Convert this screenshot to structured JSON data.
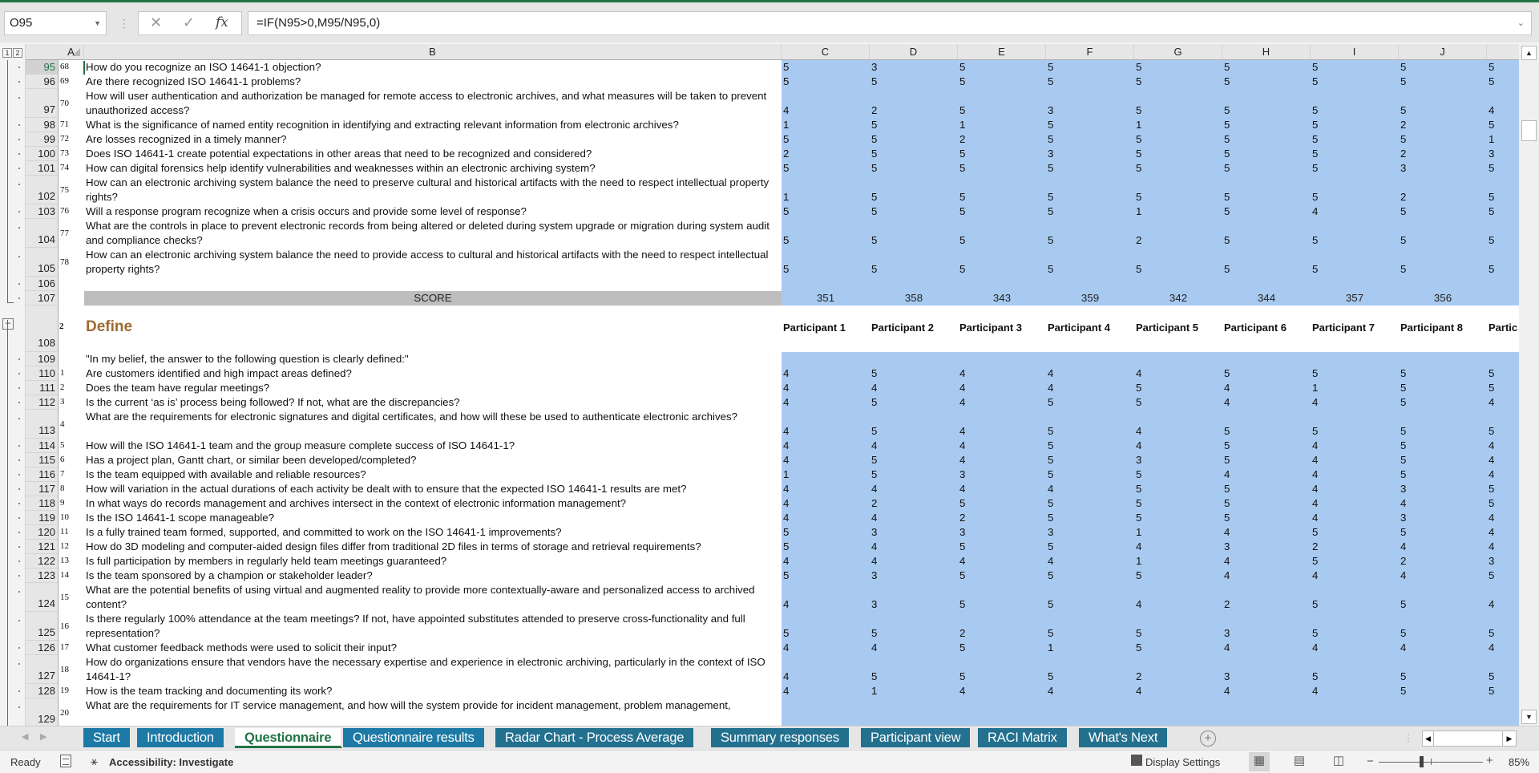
{
  "formula_bar": {
    "name_box": "O95",
    "cancel_icon": "✕",
    "enter_icon": "✓",
    "fx_label": "fx",
    "formula": "=IF(N95>0,M95/N95,0)"
  },
  "outline_levels": [
    "1",
    "2"
  ],
  "columns": [
    "A",
    "B",
    "C",
    "D",
    "E",
    "F",
    "G",
    "H",
    "I",
    "J"
  ],
  "section1_rows": [
    {
      "row": "95",
      "num": "68",
      "q": "How do you recognize an ISO 14641-1 objection?",
      "tall": false,
      "scores": [
        "5",
        "3",
        "5",
        "5",
        "5",
        "5",
        "5",
        "5",
        "5"
      ]
    },
    {
      "row": "96",
      "num": "69",
      "q": "Are there recognized ISO 14641-1 problems?",
      "tall": false,
      "scores": [
        "5",
        "5",
        "5",
        "5",
        "5",
        "5",
        "5",
        "5",
        "5"
      ]
    },
    {
      "row": "97",
      "num": "70",
      "q": "How will user authentication and authorization be managed for remote access to electronic archives, and what measures will be taken to prevent unauthorized access?",
      "tall": true,
      "scores": [
        "4",
        "2",
        "5",
        "3",
        "5",
        "5",
        "5",
        "5",
        "4"
      ]
    },
    {
      "row": "98",
      "num": "71",
      "q": "What is the significance of named entity recognition in identifying and extracting relevant information from electronic archives?",
      "tall": false,
      "scores": [
        "1",
        "5",
        "1",
        "5",
        "1",
        "5",
        "5",
        "2",
        "5"
      ]
    },
    {
      "row": "99",
      "num": "72",
      "q": "Are losses recognized in a timely manner?",
      "tall": false,
      "scores": [
        "5",
        "5",
        "2",
        "5",
        "5",
        "5",
        "5",
        "5",
        "1"
      ]
    },
    {
      "row": "100",
      "num": "73",
      "q": "Does ISO 14641-1 create potential expectations in other areas that need to be recognized and considered?",
      "tall": false,
      "scores": [
        "2",
        "5",
        "5",
        "3",
        "5",
        "5",
        "5",
        "2",
        "3"
      ]
    },
    {
      "row": "101",
      "num": "74",
      "q": "How can digital forensics help identify vulnerabilities and weaknesses within an electronic archiving system?",
      "tall": false,
      "scores": [
        "5",
        "5",
        "5",
        "5",
        "5",
        "5",
        "5",
        "3",
        "5"
      ]
    },
    {
      "row": "102",
      "num": "75",
      "q": "How can an electronic archiving system balance the need to preserve cultural and historical artifacts with the need to respect intellectual property rights?",
      "tall": true,
      "scores": [
        "1",
        "5",
        "5",
        "5",
        "5",
        "5",
        "5",
        "2",
        "5"
      ]
    },
    {
      "row": "103",
      "num": "76",
      "q": "Will a response program recognize when a crisis occurs and provide some level of response?",
      "tall": false,
      "scores": [
        "5",
        "5",
        "5",
        "5",
        "1",
        "5",
        "4",
        "5",
        "5"
      ]
    },
    {
      "row": "104",
      "num": "77",
      "q": "What are the controls in place to prevent electronic records from being altered or deleted during system upgrade or migration during system audit and compliance checks?",
      "tall": true,
      "scores": [
        "5",
        "5",
        "5",
        "5",
        "2",
        "5",
        "5",
        "5",
        "5"
      ]
    },
    {
      "row": "105",
      "num": "78",
      "q": "How can an electronic archiving system balance the need to provide access to cultural and historical artifacts with the need to respect intellectual property rights?",
      "tall": true,
      "scores": [
        "5",
        "5",
        "5",
        "5",
        "5",
        "5",
        "5",
        "5",
        "5"
      ]
    }
  ],
  "blank_row": "106",
  "score_row": {
    "row": "107",
    "label": "SCORE",
    "totals": [
      "351",
      "358",
      "343",
      "359",
      "342",
      "344",
      "357",
      "356"
    ]
  },
  "section2": {
    "row": "108",
    "num": "2",
    "title": "Define",
    "participants": [
      "Participant 1",
      "Participant 2",
      "Participant 3",
      "Participant 4",
      "Participant 5",
      "Participant 6",
      "Participant 7",
      "Participant 8",
      "Partic"
    ],
    "intro_row": "109",
    "intro": "\"In my belief, the answer to the following question is clearly defined:\""
  },
  "section2_rows": [
    {
      "row": "110",
      "num": "1",
      "q": "Are customers identified and high impact areas defined?",
      "tall": false,
      "scores": [
        "4",
        "5",
        "4",
        "4",
        "4",
        "5",
        "5",
        "5",
        "5"
      ]
    },
    {
      "row": "111",
      "num": "2",
      "q": "Does the team have regular meetings?",
      "tall": false,
      "scores": [
        "4",
        "4",
        "4",
        "4",
        "5",
        "4",
        "1",
        "5",
        "5"
      ]
    },
    {
      "row": "112",
      "num": "3",
      "q": "Is the current ‘as is’ process being followed? If not, what are the discrepancies?",
      "tall": false,
      "scores": [
        "4",
        "5",
        "4",
        "5",
        "5",
        "4",
        "4",
        "5",
        "4"
      ]
    },
    {
      "row": "113",
      "num": "4",
      "q": "What are the requirements for electronic signatures and digital certificates, and how will these be used to authenticate electronic archives?",
      "tall": true,
      "scores": [
        "4",
        "5",
        "4",
        "5",
        "4",
        "5",
        "5",
        "5",
        "5"
      ]
    },
    {
      "row": "114",
      "num": "5",
      "q": "How will the ISO 14641-1 team and the group measure complete success of ISO 14641-1?",
      "tall": false,
      "scores": [
        "4",
        "4",
        "4",
        "5",
        "4",
        "5",
        "4",
        "5",
        "4"
      ]
    },
    {
      "row": "115",
      "num": "6",
      "q": "Has a project plan, Gantt chart, or similar been developed/completed?",
      "tall": false,
      "scores": [
        "4",
        "5",
        "4",
        "5",
        "3",
        "5",
        "4",
        "5",
        "4"
      ]
    },
    {
      "row": "116",
      "num": "7",
      "q": "Is the team equipped with available and reliable resources?",
      "tall": false,
      "scores": [
        "1",
        "5",
        "3",
        "5",
        "5",
        "4",
        "4",
        "5",
        "4"
      ]
    },
    {
      "row": "117",
      "num": "8",
      "q": "How will variation in the actual durations of each activity be dealt with to ensure that the expected ISO 14641-1 results are met?",
      "tall": false,
      "scores": [
        "4",
        "4",
        "4",
        "4",
        "5",
        "5",
        "4",
        "3",
        "5"
      ]
    },
    {
      "row": "118",
      "num": "9",
      "q": "In what ways do records management and archives intersect in the context of electronic information management?",
      "tall": false,
      "scores": [
        "4",
        "2",
        "5",
        "5",
        "5",
        "5",
        "4",
        "4",
        "5"
      ]
    },
    {
      "row": "119",
      "num": "10",
      "q": "Is the ISO 14641-1 scope manageable?",
      "tall": false,
      "scores": [
        "4",
        "4",
        "2",
        "5",
        "5",
        "5",
        "4",
        "3",
        "4"
      ]
    },
    {
      "row": "120",
      "num": "11",
      "q": "Is a fully trained team formed, supported, and committed to work on the ISO 14641-1 improvements?",
      "tall": false,
      "scores": [
        "5",
        "3",
        "3",
        "3",
        "1",
        "4",
        "5",
        "5",
        "4"
      ]
    },
    {
      "row": "121",
      "num": "12",
      "q": "How do 3D modeling and computer-aided design files differ from traditional 2D files in terms of storage and retrieval requirements?",
      "tall": false,
      "scores": [
        "5",
        "4",
        "5",
        "5",
        "4",
        "3",
        "2",
        "4",
        "4"
      ]
    },
    {
      "row": "122",
      "num": "13",
      "q": "Is full participation by members in regularly held team meetings guaranteed?",
      "tall": false,
      "scores": [
        "4",
        "4",
        "4",
        "4",
        "1",
        "4",
        "5",
        "2",
        "3"
      ]
    },
    {
      "row": "123",
      "num": "14",
      "q": "Is the team sponsored by a champion or stakeholder leader?",
      "tall": false,
      "scores": [
        "5",
        "3",
        "5",
        "5",
        "5",
        "4",
        "4",
        "4",
        "5"
      ]
    },
    {
      "row": "124",
      "num": "15",
      "q": "What are the potential benefits of using virtual and augmented reality to provide more contextually-aware and personalized access to archived content?",
      "tall": true,
      "scores": [
        "4",
        "3",
        "5",
        "5",
        "4",
        "2",
        "5",
        "5",
        "4"
      ]
    },
    {
      "row": "125",
      "num": "16",
      "q": "Is there regularly 100% attendance at the team meetings? If not, have appointed substitutes attended to preserve cross-functionality and full representation?",
      "tall": true,
      "scores": [
        "5",
        "5",
        "2",
        "5",
        "5",
        "3",
        "5",
        "5",
        "5"
      ]
    },
    {
      "row": "126",
      "num": "17",
      "q": "What customer feedback methods were used to solicit their input?",
      "tall": false,
      "scores": [
        "4",
        "4",
        "5",
        "1",
        "5",
        "4",
        "4",
        "4",
        "4"
      ]
    },
    {
      "row": "127",
      "num": "18",
      "q": "How do organizations ensure that vendors have the necessary expertise and experience in electronic archiving, particularly in the context of ISO 14641-1?",
      "tall": true,
      "scores": [
        "4",
        "5",
        "5",
        "5",
        "2",
        "3",
        "5",
        "5",
        "5"
      ]
    },
    {
      "row": "128",
      "num": "19",
      "q": "How is the team tracking and documenting its work?",
      "tall": false,
      "scores": [
        "4",
        "1",
        "4",
        "4",
        "4",
        "4",
        "4",
        "5",
        "5"
      ]
    },
    {
      "row": "129",
      "num": "20",
      "q": "What are the requirements for IT service management, and how will the system provide for incident management, problem management,",
      "tall": true,
      "scores": []
    }
  ],
  "sheet_tabs": [
    {
      "label": "Start",
      "active": false
    },
    {
      "label": "Introduction",
      "active": false
    },
    {
      "label": "Questionnaire",
      "active": true
    },
    {
      "label": "Questionnaire results",
      "active": false
    },
    {
      "label": "Radar Chart - Process Average",
      "active": false
    },
    {
      "label": "Summary responses",
      "active": false
    },
    {
      "label": "Participant view",
      "active": false
    },
    {
      "label": "RACI Matrix",
      "active": false
    },
    {
      "label": "What's Next",
      "active": false
    }
  ],
  "status_bar": {
    "ready": "Ready",
    "accessibility": "Accessibility: Investigate",
    "display_settings": "Display Settings",
    "zoom": "85%"
  },
  "colors": {
    "accent": "#217346",
    "score_fill": "#a9caf0",
    "section_title": "#9e6a32",
    "tab_fill": "#1d7aa6",
    "score_label_fill": "#bdbdbd"
  }
}
